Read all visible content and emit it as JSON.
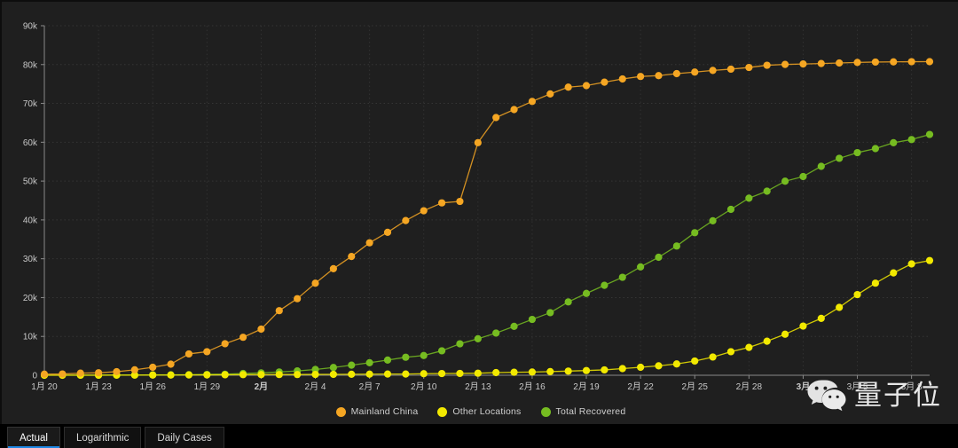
{
  "theme": {
    "background": "#1f1f1f",
    "panel_background": "#1b1b1b",
    "grid_color": "#3a3a3a",
    "axis_color": "#8a8a8a",
    "tick_text_color": "#c8c8c8",
    "tab_active_underline": "#1e88e5",
    "tabbar_background": "#000000"
  },
  "legend": {
    "position": "bottom-center",
    "items": [
      {
        "label": "Mainland China",
        "color": "#F5A623",
        "series": "mainland_china"
      },
      {
        "label": "Other Locations",
        "color": "#F2E900",
        "series": "other_locations"
      },
      {
        "label": "Total Recovered",
        "color": "#76BC21",
        "series": "total_recovered"
      }
    ]
  },
  "watermark": {
    "icon": "wechat-logo-icon",
    "text": "量子位"
  },
  "tabs": [
    {
      "label": "Actual",
      "active": true
    },
    {
      "label": "Logarithmic",
      "active": false
    },
    {
      "label": "Daily Cases",
      "active": false
    }
  ],
  "chart_data": {
    "type": "line",
    "title": "",
    "subtitle": "",
    "xlabel": "",
    "ylabel": "",
    "grid": true,
    "legend_position": "bottom",
    "ylim": [
      0,
      90000
    ],
    "y_ticks": [
      0,
      10000,
      20000,
      30000,
      40000,
      50000,
      60000,
      70000,
      80000,
      90000
    ],
    "y_tick_labels": [
      "0",
      "10k",
      "20k",
      "30k",
      "40k",
      "50k",
      "60k",
      "70k",
      "80k",
      "90k"
    ],
    "x_tick_labels": [
      "1月 20",
      "1月 23",
      "1月 26",
      "1月 29",
      "2月",
      "2月 4",
      "2月 7",
      "2月 10",
      "2月 13",
      "2月 16",
      "2月 19",
      "2月 22",
      "2月 25",
      "2月 28",
      "3月",
      "3月 5",
      "3月 8"
    ],
    "x_tick_bold": [
      false,
      false,
      false,
      false,
      true,
      false,
      false,
      false,
      false,
      false,
      false,
      false,
      false,
      false,
      true,
      false,
      false
    ],
    "x_tick_indices": [
      0,
      3,
      6,
      9,
      12,
      15,
      18,
      21,
      24,
      27,
      30,
      33,
      36,
      39,
      42,
      45,
      48
    ],
    "x": [
      "1月20",
      "1月21",
      "1月22",
      "1月23",
      "1月24",
      "1月25",
      "1月26",
      "1月27",
      "1月28",
      "1月29",
      "1月30",
      "1月31",
      "2月1",
      "2月2",
      "2月3",
      "2月4",
      "2月5",
      "2月6",
      "2月7",
      "2月8",
      "2月9",
      "2月10",
      "2月11",
      "2月12",
      "2月13",
      "2月14",
      "2月15",
      "2月16",
      "2月17",
      "2月18",
      "2月19",
      "2月20",
      "2月21",
      "2月22",
      "2月23",
      "2月24",
      "2月25",
      "2月26",
      "2月27",
      "2月28",
      "2月29",
      "3月1",
      "3月2",
      "3月3",
      "3月4",
      "3月5",
      "3月6",
      "3月7",
      "3月8",
      "3月9"
    ],
    "series": [
      {
        "name": "Mainland China",
        "color": "#F5A623",
        "values": [
          278,
          326,
          547,
          639,
          916,
          1399,
          2062,
          2863,
          5494,
          6070,
          8124,
          9783,
          11871,
          16630,
          19716,
          23707,
          27440,
          30587,
          34110,
          36814,
          39829,
          42354,
          44386,
          44759,
          59895,
          66358,
          68413,
          70513,
          72436,
          74185,
          74576,
          75465,
          76288,
          76936,
          77150,
          77658,
          78064,
          78497,
          78824,
          79251,
          79824,
          80026,
          80151,
          80270,
          80409,
          80552,
          80651,
          80695,
          80735,
          80754
        ]
      },
      {
        "name": "Other Locations",
        "color": "#F2E900",
        "values": [
          4,
          6,
          8,
          14,
          25,
          40,
          57,
          64,
          87,
          105,
          124,
          153,
          174,
          183,
          188,
          212,
          227,
          265,
          288,
          307,
          319,
          395,
          441,
          476,
          524,
          683,
          780,
          824,
          947,
          1076,
          1212,
          1385,
          1715,
          2055,
          2429,
          2918,
          3664,
          4691,
          6068,
          7170,
          8774,
          10566,
          12668,
          14653,
          17479,
          20777,
          23712,
          26356,
          28674,
          29540
        ]
      },
      {
        "name": "Total Recovered",
        "color": "#76BC21",
        "values": [
          28,
          30,
          36,
          39,
          49,
          58,
          101,
          120,
          135,
          214,
          275,
          463,
          614,
          843,
          1115,
          1477,
          1999,
          2596,
          3219,
          3918,
          4636,
          5082,
          6296,
          8096,
          9395,
          10865,
          12583,
          14376,
          16121,
          18890,
          21074,
          23157,
          25227,
          27905,
          30384,
          33277,
          36711,
          39782,
          42716,
          45602,
          47404,
          49963,
          51171,
          53796,
          55865,
          57320,
          58358,
          59880,
          60694,
          62000
        ]
      }
    ]
  }
}
